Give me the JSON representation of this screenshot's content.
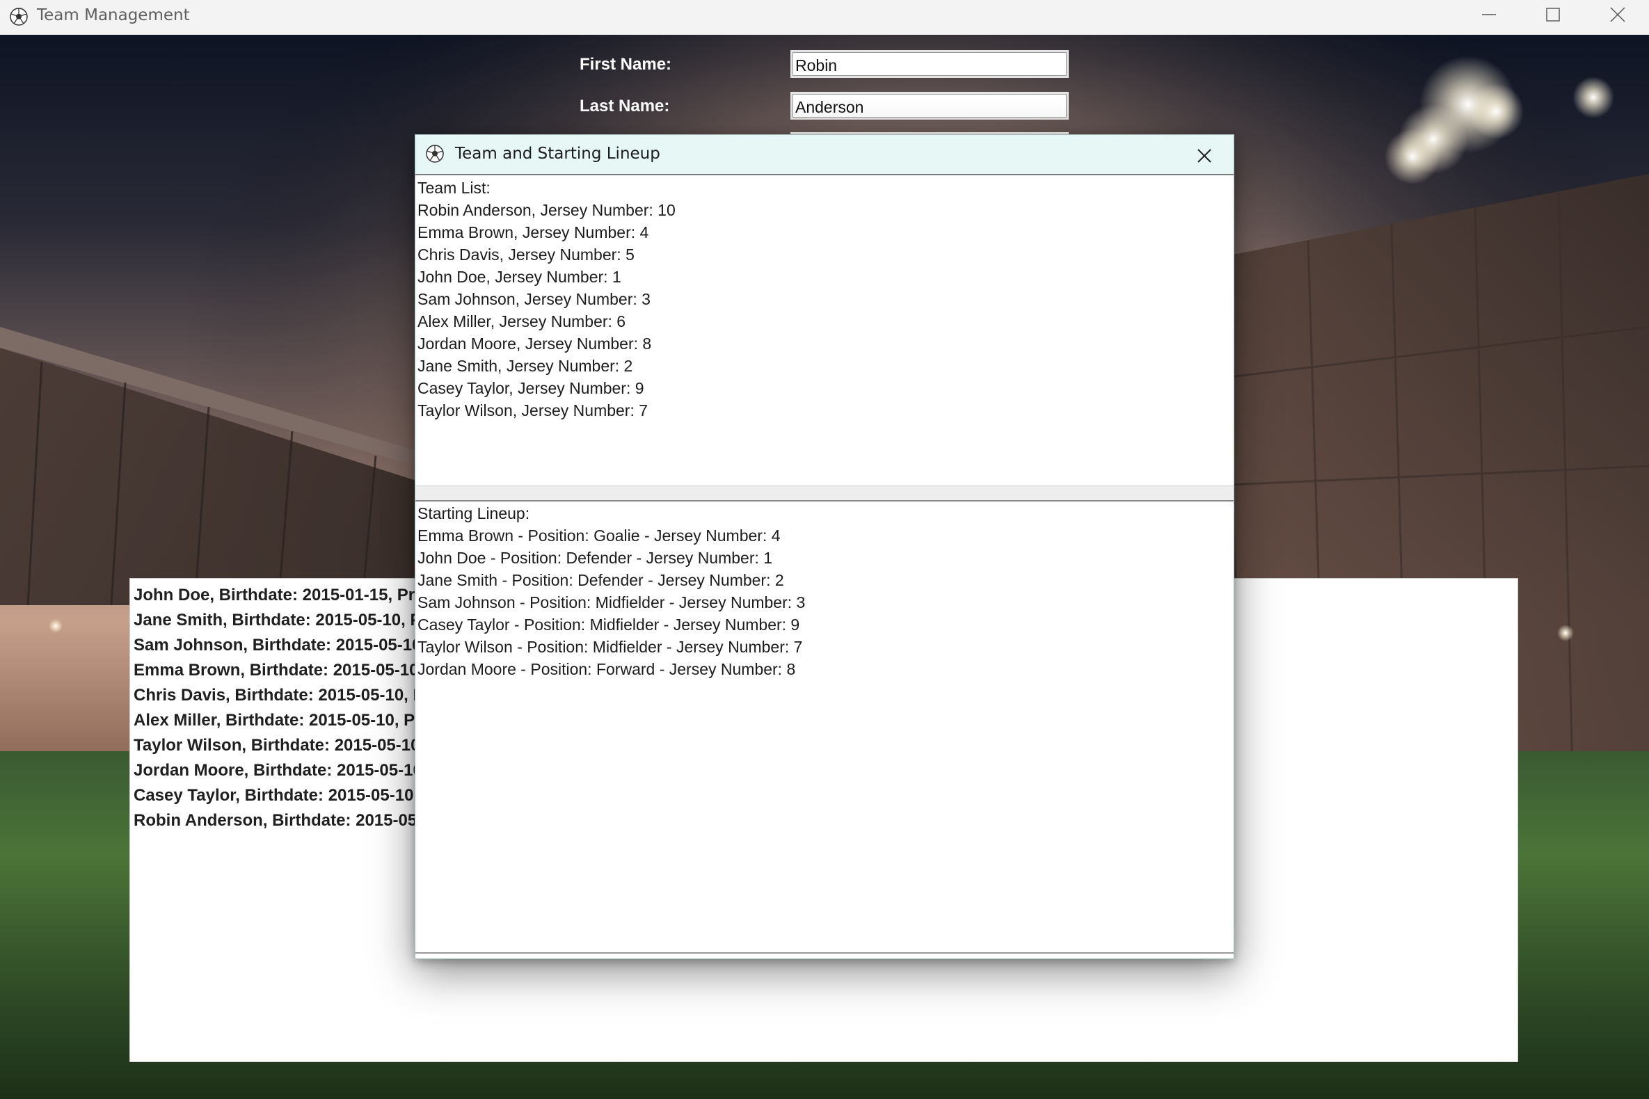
{
  "window": {
    "title": "Team Management",
    "icon": "soccer-ball-icon",
    "controls": [
      "minimize-icon",
      "maximize-icon",
      "close-icon"
    ]
  },
  "form": {
    "first_name_label": "First Name:",
    "first_name_value": "Robin",
    "last_name_label": "Last Name:",
    "last_name_value": "Anderson"
  },
  "player_list": [
    "John Doe, Birthdate: 2015-01-15, Pr",
    "Jane Smith, Birthdate: 2015-05-10, P",
    "Sam Johnson, Birthdate: 2015-05-10",
    "Emma Brown, Birthdate: 2015-05-10",
    "Chris Davis, Birthdate: 2015-05-10, P",
    "Alex Miller, Birthdate: 2015-05-10, Pr",
    "Taylor Wilson, Birthdate: 2015-05-10",
    "Jordan Moore, Birthdate: 2015-05-10",
    "Casey Taylor, Birthdate: 2015-05-10,",
    "Robin Anderson, Birthdate: 2015-05"
  ],
  "dialog": {
    "title": "Team and Starting Lineup",
    "icon": "soccer-ball-icon",
    "team_list": {
      "header": "Team List:",
      "items": [
        "Robin Anderson, Jersey Number: 10",
        "Emma Brown, Jersey Number: 4",
        "Chris Davis, Jersey Number: 5",
        "John Doe, Jersey Number: 1",
        "Sam Johnson, Jersey Number: 3",
        "Alex Miller, Jersey Number: 6",
        "Jordan Moore, Jersey Number: 8",
        "Jane Smith, Jersey Number: 2",
        "Casey Taylor, Jersey Number: 9",
        "Taylor Wilson, Jersey Number: 7"
      ]
    },
    "starting_lineup": {
      "header": "Starting Lineup:",
      "items": [
        "Emma Brown - Position: Goalie - Jersey Number: 4",
        "John Doe - Position: Defender - Jersey Number: 1",
        "Jane Smith - Position: Defender - Jersey Number: 2",
        "Sam Johnson - Position: Midfielder - Jersey Number: 3",
        "Casey Taylor - Position: Midfielder - Jersey Number: 9",
        "Taylor Wilson - Position: Midfielder - Jersey Number: 7",
        "Jordan Moore - Position: Forward - Jersey Number: 8"
      ]
    }
  },
  "colors": {
    "titlebar": "#f3f3f3",
    "dialog_titlebar": "#e6f7f5",
    "form_label": "#ffffff"
  }
}
